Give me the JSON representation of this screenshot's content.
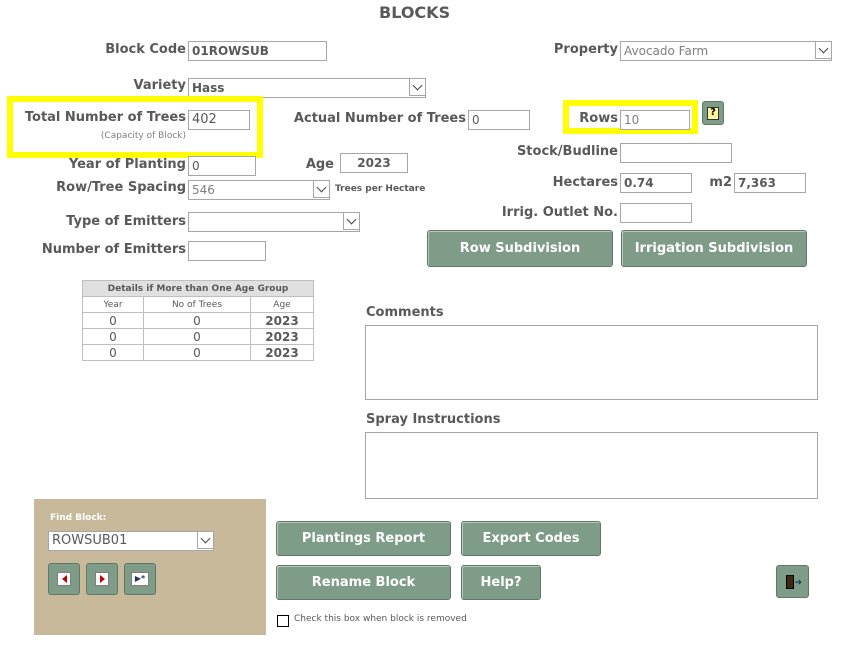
{
  "title": "BLOCKS",
  "block_code": {
    "label": "Block Code",
    "value": "01ROWSUB"
  },
  "property": {
    "label": "Property",
    "value": "Avocado Farm"
  },
  "variety": {
    "label": "Variety",
    "value": "Hass"
  },
  "total_trees": {
    "label": "Total Number of Trees",
    "sublabel": "(Capacity of Block)",
    "value": "402"
  },
  "actual_trees": {
    "label": "Actual Number of Trees",
    "value": "0"
  },
  "rows": {
    "label": "Rows",
    "value": "10"
  },
  "help_icon": "question-icon",
  "year_planting": {
    "label": "Year of Planting",
    "value": "0"
  },
  "age": {
    "label": "Age",
    "value": "2023"
  },
  "stock": {
    "label": "Stock/Budline",
    "value": ""
  },
  "spacing": {
    "label": "Row/Tree Spacing",
    "value": "546",
    "suffix": "Trees per Hectare"
  },
  "hectares": {
    "label": "Hectares",
    "value": "0.74"
  },
  "m2": {
    "label": "m2",
    "value": "7,363"
  },
  "emitter_type": {
    "label": "Type of Emitters",
    "value": ""
  },
  "irrig_outlet": {
    "label": "Irrig. Outlet No.",
    "value": ""
  },
  "emitter_count": {
    "label": "Number of Emitters",
    "value": ""
  },
  "buttons": {
    "row_subdivision": "Row Subdivision",
    "irrigation_subdivision": "Irrigation Subdivision",
    "plantings_report": "Plantings Report",
    "export_codes": "Export Codes",
    "rename_block": "Rename Block",
    "help": "Help?"
  },
  "age_table": {
    "title": "Details if More than One Age Group",
    "columns": [
      "Year",
      "No of Trees",
      "Age"
    ],
    "rows": [
      [
        "0",
        "0",
        "2023"
      ],
      [
        "0",
        "0",
        "2023"
      ],
      [
        "0",
        "0",
        "2023"
      ]
    ]
  },
  "comments": {
    "label": "Comments",
    "value": ""
  },
  "spray": {
    "label": "Spray Instructions",
    "value": ""
  },
  "find": {
    "label": "Find Block:",
    "value": "ROWSUB01"
  },
  "nav_icons": [
    "prev-record-icon",
    "next-record-icon",
    "new-record-icon"
  ],
  "removed_checkbox": {
    "label": "Check this box when block is removed",
    "checked": false
  },
  "exit_icon": "exit-door-icon",
  "highlight_color": "#ffff00",
  "button_color": "#7f9c88"
}
